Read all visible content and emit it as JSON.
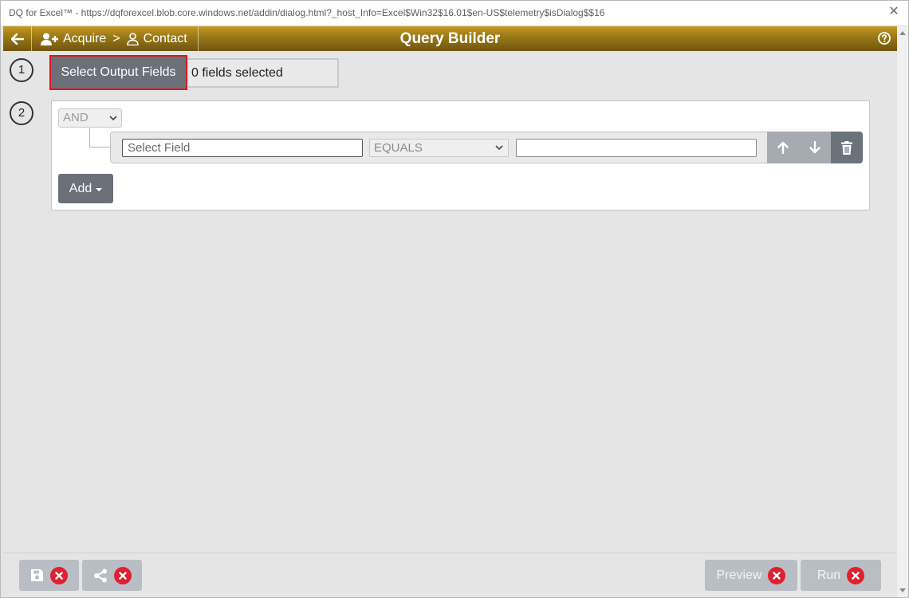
{
  "window": {
    "title": "DQ for Excel™ - https://dqforexcel.blob.core.windows.net/addin/dialog.html?_host_Info=Excel$Win32$16.01$en-US$telemetry$isDialog$$16",
    "close_glyph": "✕"
  },
  "header": {
    "breadcrumb": [
      {
        "label": "Acquire",
        "icon": "user-plus-icon"
      },
      {
        "label": "Contact",
        "icon": "user-outline-icon"
      }
    ],
    "separator": ">",
    "title": "Query Builder",
    "help_icon": "question-circle-icon",
    "background_colors": [
      "#c39a22",
      "#6f5510"
    ]
  },
  "step1": {
    "number": "1",
    "button_label": "Select Output Fields",
    "count_text": "0 fields selected"
  },
  "step2": {
    "number": "2",
    "conjunction": "AND",
    "rule": {
      "field_placeholder": "Select Field",
      "operator": "EQUALS",
      "value": ""
    },
    "add_label": "Add"
  },
  "footer": {
    "preview_label": "Preview",
    "run_label": "Run",
    "status_color": "#de2030"
  }
}
